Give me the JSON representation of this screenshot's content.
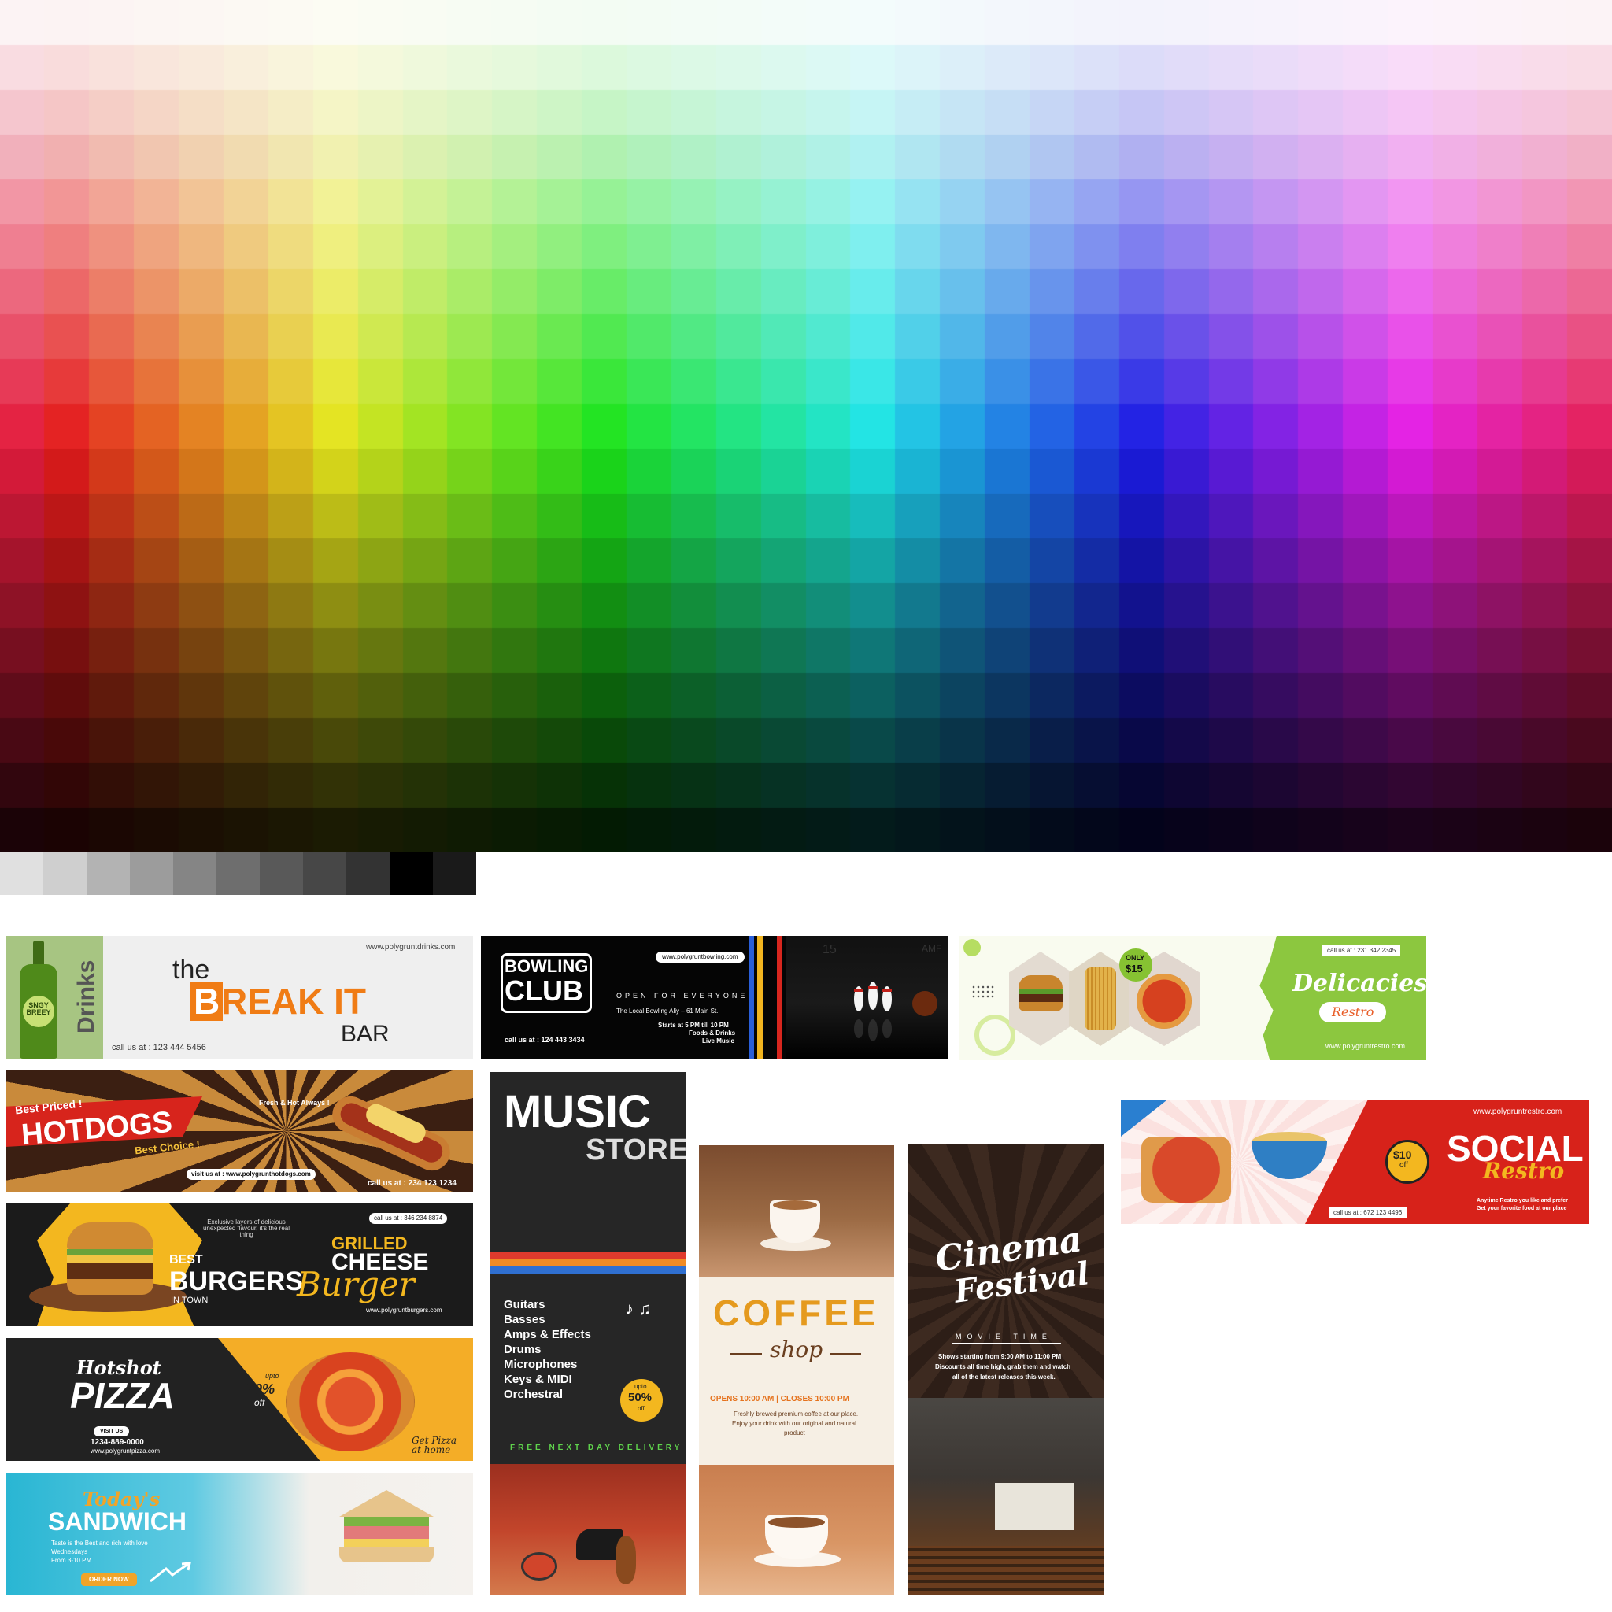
{
  "palette": {
    "gray_swatches": [
      "#e0e0e0",
      "#cfcfcf",
      "#b3b3b3",
      "#9c9c9c",
      "#858585",
      "#6e6e6e",
      "#595959",
      "#474747",
      "#333333",
      "#000000",
      "#1a1a1a"
    ]
  },
  "drinks": {
    "side": "Drinks",
    "bottle_label": "SNGY BREEY",
    "url": "www.polygruntdrinks.com",
    "the": "the",
    "b": "B",
    "reak": "REAK IT",
    "bar": "BAR",
    "call": "call us at : 123 444 5456"
  },
  "bowling": {
    "title1": "BOWLING",
    "title2": "CLUB",
    "url": "www.polygruntbowling.com",
    "open": "OPEN FOR EVERYONE",
    "address": "The Local Bowling Aliy – 61 Main St.",
    "hours": "Starts at 5 PM till 10 PM",
    "line2": "Foods & Drinks",
    "line3": "Live Music",
    "call": "call us at : 124 443 3434",
    "lane_num": "15",
    "lane_brand": "AMF"
  },
  "delicacies": {
    "only": "ONLY",
    "price": "$15",
    "call": "call us at : 231 342 2345",
    "title": "Delicacies",
    "sub": "Restro",
    "url": "www.polygruntrestro.com"
  },
  "hotdogs": {
    "best_priced": "Best Priced !",
    "title": "HOTDOGS",
    "choice": "Best Choice !",
    "fresh": "Fresh & Hot Always !",
    "visit": "visit us at : www.polygrunthotdogs.com",
    "call": "call us at : 234 123 1234"
  },
  "burgers": {
    "desc": "Exclusive layers of delicious unexpected flavour, it's the real thing",
    "call": "call us at : 346 234 8874",
    "best": "BEST",
    "burgers": "BURGERS",
    "town": "IN TOWN",
    "grilled": "GRILLED",
    "cheese": "CHEESE",
    "burger": "Burger",
    "url": "www.polygruntburgers.com"
  },
  "pizza": {
    "hotshot": "Hotshot",
    "title": "PIZZA",
    "upto": "upto",
    "pct": "70%",
    "off": "off",
    "visit": "VISIT US",
    "phone": "1234-889-0000",
    "url": "www.polygruntpizza.com",
    "get": "Get Pizza",
    "home": "at home"
  },
  "sandwich": {
    "todays": "Today's",
    "title": "SANDWICH",
    "desc1": "Taste is the Best and rich with love",
    "desc2": "Wednesdays",
    "desc3": "From 3-10 PM",
    "order": "ORDER NOW"
  },
  "music": {
    "title1": "MUSIC",
    "title2": "STORE",
    "items": [
      "Guitars",
      "Basses",
      "Amps & Effects",
      "Drums",
      "Microphones",
      "Keys & MIDI",
      "Orchestral"
    ],
    "upto": "upto",
    "pct": "50%",
    "off": "off",
    "delivery": "FREE NEXT DAY DELIVERY"
  },
  "coffee": {
    "title": "COFFEE",
    "shop": "shop",
    "hours": "OPENS 10:00 AM | CLOSES 10:00 PM",
    "desc1": "Freshly brewed premium coffee at our place.",
    "desc2": "Enjoy your drink with our original and natural",
    "desc3": "product"
  },
  "cinema": {
    "title1": "Cinema",
    "title2": "Festival",
    "time": "MOVIE TIME",
    "desc1": "Shows starting from 9:00 AM to 11:00 PM",
    "desc2": "Discounts all time high, grab them and watch",
    "desc3": "all of the latest releases this week."
  },
  "social": {
    "url": "www.polygruntrestro.com",
    "price": "$10",
    "off": "off",
    "title": "SOCIAL",
    "sub": "Restro",
    "desc1": "Anytime Restro you like and prefer",
    "desc2": "Get your favorite food at our place",
    "call": "call us at : 672 123 4496"
  }
}
